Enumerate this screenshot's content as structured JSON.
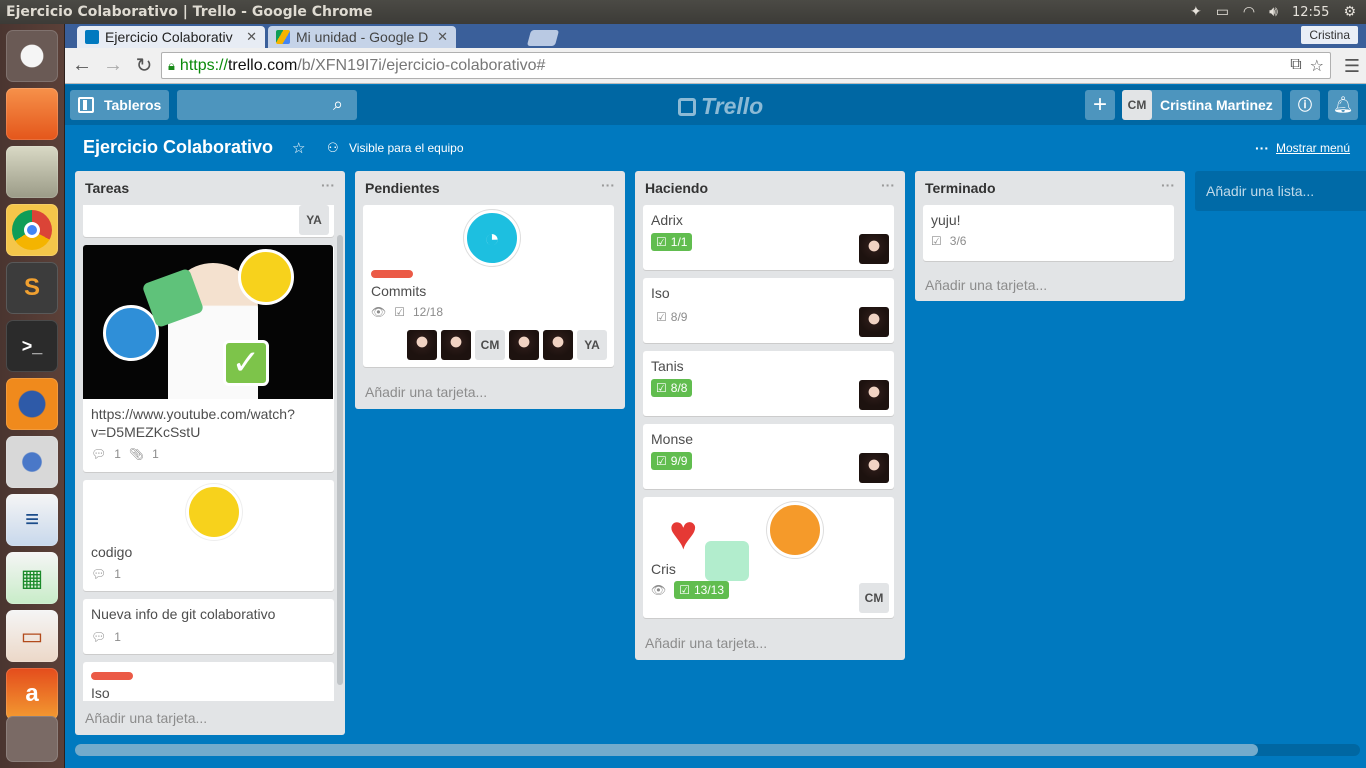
{
  "os": {
    "window_title": "Ejercicio Colaborativo | Trello - Google Chrome",
    "clock": "12:55"
  },
  "browser": {
    "tabs": [
      {
        "label": "Ejercicio Colaborativ"
      },
      {
        "label": "Mi unidad - Google D"
      }
    ],
    "profile": "Cristina",
    "url_scheme": "https://",
    "url_host": "trello.com",
    "url_path": "/b/XFN19I7i/ejercicio-colaborativo#"
  },
  "trello": {
    "boards_label": "Tableros",
    "logo": "Trello",
    "member_initials": "CM",
    "member_name": "Cristina Martinez"
  },
  "board": {
    "title": "Ejercicio Colaborativo",
    "visibility": "Visible para el equipo",
    "show_menu": "Mostrar menú",
    "add_list": "Añadir una lista...",
    "add_card": "Añadir una tarjeta..."
  },
  "lists": {
    "tareas": {
      "title": "Tareas",
      "top_avatar": "YA",
      "card1": {
        "title": "https://www.youtube.com/watch?v=D5MEZKcSstU",
        "comments": "1",
        "attachments": "1"
      },
      "card2": {
        "title": "codigo",
        "comments": "1"
      },
      "card3": {
        "title": "Nueva info de git colaborativo",
        "comments": "1"
      },
      "card4": {
        "title": "Iso"
      }
    },
    "pendientes": {
      "title": "Pendientes",
      "card1": {
        "title": "Commits",
        "checklist": "12/18",
        "avatar_cm": "CM",
        "avatar_ya": "YA"
      }
    },
    "haciendo": {
      "title": "Haciendo",
      "cards": [
        {
          "title": "Adrix",
          "checklist": "1/1"
        },
        {
          "title": "Iso",
          "checklist": "8/9"
        },
        {
          "title": "Tanis",
          "checklist": "8/8"
        },
        {
          "title": "Monse",
          "checklist": "9/9"
        },
        {
          "title": "Cris",
          "checklist": "13/13",
          "avatar": "CM"
        }
      ]
    },
    "terminado": {
      "title": "Terminado",
      "card1": {
        "title": "yuju!",
        "checklist": "3/6"
      }
    }
  },
  "colors": {
    "board_bg": "#0079bf",
    "header_bg": "#0067a3",
    "label_red": "#eb5a46",
    "check_done": "#61bd4f"
  }
}
